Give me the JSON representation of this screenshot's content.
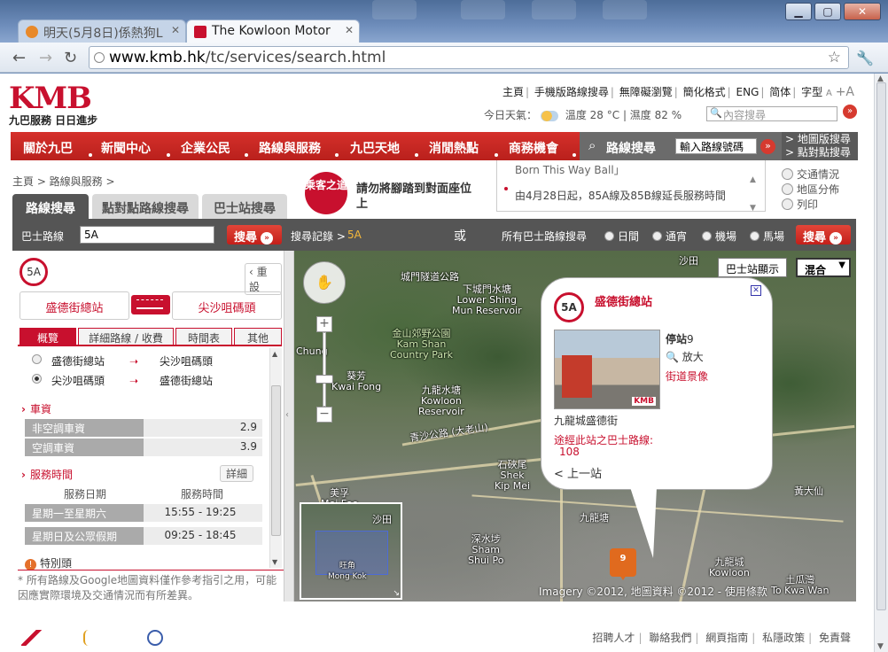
{
  "browser": {
    "tabs": [
      {
        "title": "明天(5月8日)係熱狗L"
      },
      {
        "title": "The Kowloon Motor"
      }
    ],
    "url_domain": "www.kmb.hk",
    "url_path": "/tc/services/search.html"
  },
  "header": {
    "logo_text": "KMB",
    "logo_sub": "九巴服務 日日進步",
    "top_links": [
      "主頁",
      "手機版路線搜尋",
      "無障礙瀏覽",
      "簡化格式",
      "ENG",
      "简体",
      "字型"
    ],
    "font_small": "A",
    "font_large": "+A",
    "weather_label": "今日天氣：",
    "temperature": "溫度 28 °C",
    "humidity": "濕度 82 %",
    "search_placeholder": "內容搜尋"
  },
  "main_nav": {
    "items": [
      "關於九巴",
      "新聞中心",
      "企業公民",
      "路線與服務",
      "九巴天地",
      "消閒熱點",
      "商務機會"
    ],
    "route_search_label": "路線搜尋",
    "route_search_placeholder": "輸入路線號碼",
    "side_links": [
      "> 地圖版搜尋",
      "> 點對點搜尋"
    ]
  },
  "breadcrumb": "主頁 > 路線與服務 >",
  "notice": {
    "badge": "乘客之道",
    "text": "請勿將腳踏到對面座位上"
  },
  "news": {
    "items": [
      "Born This Way Ball」",
      "由4月28日起，85A線及85B線延長服務時間"
    ]
  },
  "side_links": [
    "交通情況",
    "地區分佈",
    "列印"
  ],
  "search_tabs": [
    "路線搜尋",
    "點對點路線搜尋",
    "巴士站搜尋"
  ],
  "route_bar": {
    "route_label": "巴士路線",
    "route_value": "5A",
    "search_button": "搜尋",
    "history_label": "搜尋記錄 >",
    "history_value": "5A",
    "or_label": "或",
    "all_label": "所有巴士路線搜尋",
    "options": [
      "日間",
      "通宵",
      "機場",
      "馬場"
    ]
  },
  "panel": {
    "route": "5A",
    "reset": "‹ 重設",
    "from": "盛德街總站",
    "to": "尖沙咀碼頭",
    "tabs": [
      "概覽",
      "詳細路線 / 收費",
      "時間表",
      "其他"
    ],
    "directions": [
      {
        "from": "盛德街總站",
        "to": "尖沙咀碼頭"
      },
      {
        "from": "尖沙咀碼頭",
        "to": "盛德街總站"
      }
    ],
    "fare_title": "車資",
    "fares": [
      {
        "label": "非空調車資",
        "value": "2.9"
      },
      {
        "label": "空調車資",
        "value": "3.9"
      }
    ],
    "service_title": "服務時間",
    "detail_button": "詳細",
    "service_headers": [
      "服務日期",
      "服務時間"
    ],
    "services": [
      {
        "day": "星期一至星期六",
        "time": "15:55 - 19:25"
      },
      {
        "day": "星期日及公眾假期",
        "time": "09:25 - 18:45"
      }
    ],
    "special": "特別頭",
    "footnote": "* 所有路線及Google地圖資料僅作參考指引之用，可能因應實際環境及交通情況而有所差異。"
  },
  "map": {
    "type_buttons": [
      "巴士站顯示",
      "混合"
    ],
    "labels": [
      "城門隧道公路",
      "下城門水塘\nLower Shing\nMun Reservoir",
      "金山郊野公園\nKam Shan\nCountry Park",
      "九龍水塘\nKowloon\nReservoir",
      "葵芳\nKwai Fong",
      "美孚\nMei Foo",
      "石硤尾\nShek\nKip Mei",
      "深水埗\nSham\nShui Po",
      "沙田",
      "九龍城\nKowloon",
      "黃大仙",
      "土瓜灣\nTo Kwa Wan",
      "九龍塘",
      "青沙公路 (大老山)",
      "Chung"
    ],
    "overview_labels": [
      "沙田",
      "旺角\nMong Kok"
    ],
    "imagery": "Imagery ©2012, 地圖資料 ©2012 - 使用條款",
    "bus_stop_no": "9",
    "popup": {
      "route": "5A",
      "title": "盛德街總站",
      "stop_label": "停站",
      "stop_no": "9",
      "enlarge": "放大",
      "street_view": "街道景像",
      "stop_name": "九龍城盛德街",
      "routes_label": "途經此站之巴士路線:",
      "routes": "108",
      "prev": "< 上一站"
    }
  },
  "footer": {
    "links": [
      "招聘人才",
      "聯絡我們",
      "網頁指南",
      "私隱政策",
      "免責聲"
    ]
  },
  "colors": {
    "brand": "#c8102e",
    "nav_bg": "#c41f1a",
    "bar_bg": "#555555"
  }
}
